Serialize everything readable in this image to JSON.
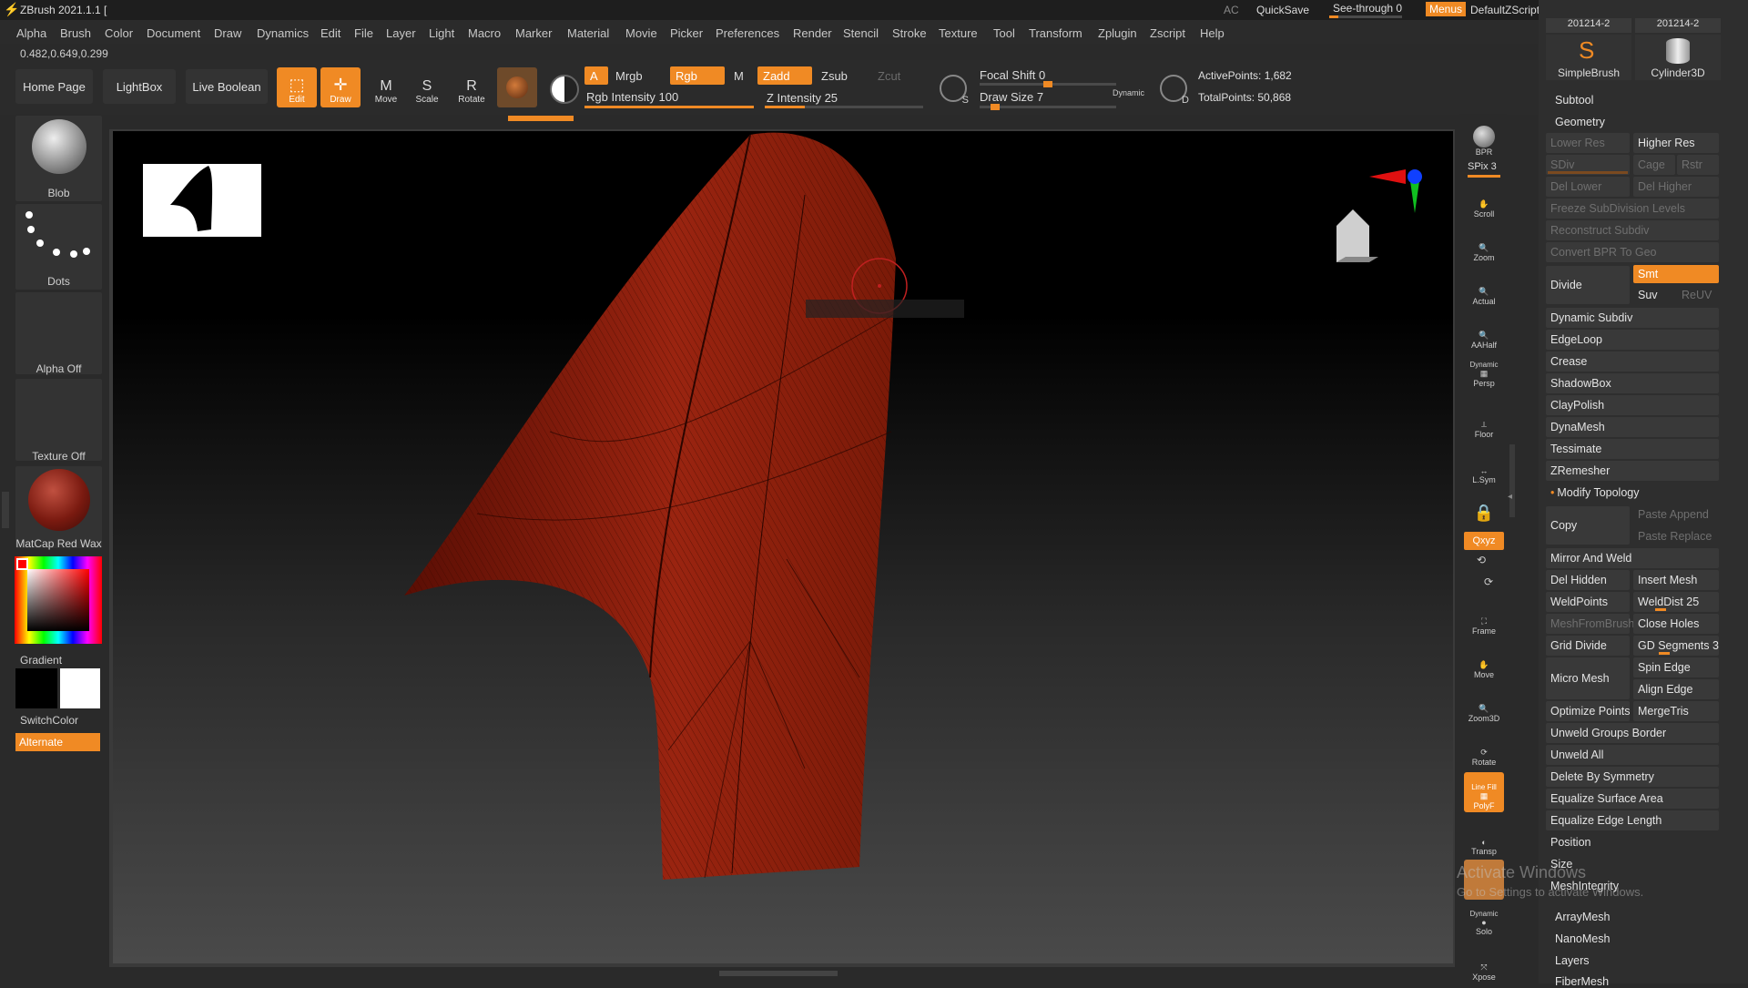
{
  "titlebar": {
    "app_title": "ZBrush 2021.1.1 [",
    "ac": "AC",
    "quicksave": "QuickSave",
    "see_through": "See-through  0",
    "menus": "Menus",
    "default_zscript": "DefaultZScript"
  },
  "menus": [
    "Alpha",
    "Brush",
    "Color",
    "Document",
    "Draw",
    "Dynamics",
    "Edit",
    "File",
    "Layer",
    "Light",
    "Macro",
    "Marker",
    "Material",
    "Movie",
    "Picker",
    "Preferences",
    "Render",
    "Stencil",
    "Stroke",
    "Texture",
    "Tool",
    "Transform",
    "Zplugin",
    "Zscript",
    "Help"
  ],
  "coords": "0.482,0.649,0.299",
  "nav": {
    "home": "Home Page",
    "lightbox": "LightBox",
    "live_boolean": "Live Boolean"
  },
  "tools": {
    "edit": "Edit",
    "draw": "Draw",
    "move": "Move",
    "scale": "Scale",
    "rotate": "Rotate"
  },
  "modes": {
    "a": "A",
    "mrgb": "Mrgb",
    "rgb": "Rgb",
    "m": "M",
    "zadd": "Zadd",
    "zsub": "Zsub",
    "zcut": "Zcut",
    "rgb_intensity": "Rgb Intensity 100",
    "z_intensity": "Z Intensity 25",
    "focal_shift": "Focal Shift 0",
    "draw_size": "Draw Size 7",
    "dynamic": "Dynamic",
    "s": "S",
    "d": "D",
    "active_points": "ActivePoints: 1,682",
    "total_points": "TotalPoints: 50,868"
  },
  "levels": {
    "rgb_intensity": 100,
    "z_intensity": 25,
    "focal_shift": 0,
    "draw_size": 7
  },
  "left_tray": {
    "brush": "Blob",
    "stroke": "Dots",
    "alpha": "Alpha Off",
    "texture": "Texture Off",
    "material": "MatCap Red Wax",
    "gradient": "Gradient",
    "switchcolor": "SwitchColor",
    "alternate": "Alternate"
  },
  "shelf": {
    "bpr": "BPR",
    "spix": "SPix 3",
    "scroll": "Scroll",
    "zoom": "Zoom",
    "actual": "Actual",
    "aahalf": "AAHalf",
    "dynamic": "Dynamic",
    "persp": "Persp",
    "floor": "Floor",
    "lsym": "L.Sym",
    "xyz": "Qxyz",
    "frame": "Frame",
    "move": "Move",
    "zoom3d": "Zoom3D",
    "rotate": "Rotate",
    "line_fill": "Line Fill",
    "polyf": "PolyF",
    "transp": "Transp",
    "solo_dyn": "Dynamic",
    "solo": "Solo",
    "xpose": "Xpose"
  },
  "right": {
    "thumb1": "201214-2",
    "thumb2": "201214-2",
    "simplebrush": "SimpleBrush",
    "cylinder": "Cylinder3D",
    "subtool": "Subtool",
    "geometry": "Geometry",
    "lower_res": "Lower Res",
    "higher_res": "Higher Res",
    "sdiv": "SDiv",
    "cage": "Cage",
    "rstr": "Rstr",
    "del_lower": "Del Lower",
    "del_higher": "Del Higher",
    "freeze": "Freeze SubDivision Levels",
    "reconstruct": "Reconstruct Subdiv",
    "convert_bpr": "Convert BPR To Geo",
    "divide": "Divide",
    "smt": "Smt",
    "suv": "Suv",
    "reuv": "ReUV",
    "dynamic_subdiv": "Dynamic Subdiv",
    "edgeloop": "EdgeLoop",
    "crease": "Crease",
    "shadowbox": "ShadowBox",
    "claypolish": "ClayPolish",
    "dynamesh": "DynaMesh",
    "tessimate": "Tessimate",
    "zremesher": "ZRemesher",
    "modify_topology": "Modify Topology",
    "copy": "Copy",
    "paste_append": "Paste Append",
    "paste_replace": "Paste Replace",
    "mirror_weld": "Mirror And Weld",
    "del_hidden": "Del Hidden",
    "insert_mesh": "Insert Mesh",
    "weldpoints": "WeldPoints",
    "welddist": "WeldDist 25",
    "meshfrombrush": "MeshFromBrush",
    "close_holes": "Close Holes",
    "grid_divide": "Grid Divide",
    "gd_segments": "GD Segments 3",
    "micro_mesh": "Micro Mesh",
    "spin_edge": "Spin Edge",
    "align_edge": "Align Edge",
    "optimize_points": "Optimize Points",
    "mergetris": "MergeTris",
    "unweld_groups": "Unweld Groups Border",
    "unweld_all": "Unweld All",
    "delete_symmetry": "Delete By Symmetry",
    "equalize_area": "Equalize Surface Area",
    "equalize_edge": "Equalize Edge Length",
    "position": "Position",
    "size": "Size",
    "meshintegrity": "MeshIntegrity",
    "arraymesh": "ArrayMesh",
    "nanomesh": "NanoMesh",
    "layers": "Layers",
    "fibermesh": "FiberMesh"
  },
  "watermark": {
    "line1": "Activate Windows",
    "line2": "Go to Settings to activate Windows."
  },
  "colors": {
    "accent": "#f08a24",
    "mesh": "#8a1a08",
    "panel": "#393939"
  }
}
